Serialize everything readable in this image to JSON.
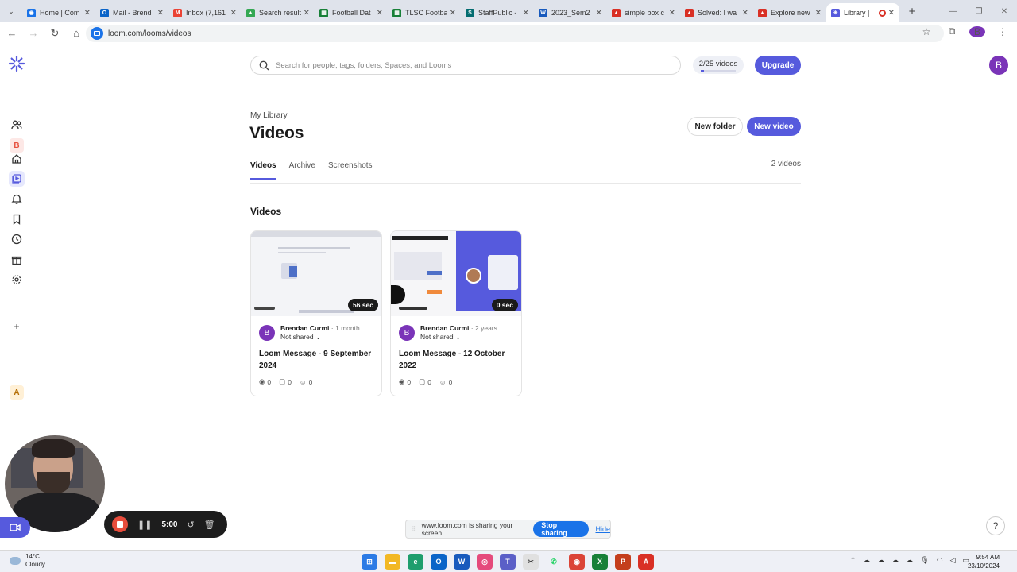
{
  "browser": {
    "tabs": [
      {
        "title": "Home | Com",
        "color": "#1a73e8",
        "glyph": "◉"
      },
      {
        "title": "Mail - Brend",
        "color": "#0a64c8",
        "glyph": "O"
      },
      {
        "title": "Inbox (7,161",
        "color": "#ea4335",
        "glyph": "M"
      },
      {
        "title": "Search result",
        "color": "#34a853",
        "glyph": "▲"
      },
      {
        "title": "Football Dat",
        "color": "#188038",
        "glyph": "▦"
      },
      {
        "title": "TLSC Footba",
        "color": "#188038",
        "glyph": "▦"
      },
      {
        "title": "StaffPublic -",
        "color": "#036c70",
        "glyph": "S"
      },
      {
        "title": "2023_Sem2",
        "color": "#185abd",
        "glyph": "W"
      },
      {
        "title": "simple box c",
        "color": "#d93025",
        "glyph": "▲"
      },
      {
        "title": "Solved: I wa",
        "color": "#d93025",
        "glyph": "▲"
      },
      {
        "title": "Explore new",
        "color": "#d93025",
        "glyph": "▲"
      },
      {
        "title": "Library |",
        "color": "#565add",
        "glyph": "✳"
      }
    ],
    "url": "loom.com/looms/videos",
    "profile_initial": "B"
  },
  "sidebar": {
    "workspace_initial": "B",
    "workspace2_initial": "A"
  },
  "search": {
    "placeholder": "Search for people, tags, folders, Spaces, and Looms"
  },
  "quota": {
    "label": "2/25 videos",
    "fraction": 0.08
  },
  "upgrade_label": "Upgrade",
  "user_initial": "B",
  "page": {
    "breadcrumb": "My Library",
    "title": "Videos",
    "new_folder_label": "New folder",
    "new_video_label": "New video",
    "tabs": [
      "Videos",
      "Archive",
      "Screenshots"
    ],
    "video_count": "2 videos",
    "section_title": "Videos"
  },
  "videos": [
    {
      "author": "Brendan Curmi",
      "age": "1 month",
      "sharing": "Not shared",
      "title": "Loom Message - 9 September 2024",
      "duration": "56 sec",
      "views": "0",
      "comments": "0",
      "reactions": "0",
      "initial": "B"
    },
    {
      "author": "Brendan Curmi",
      "age": "2 years",
      "sharing": "Not shared",
      "title": "Loom Message - 12 October 2022",
      "duration": "0 sec",
      "views": "0",
      "comments": "0",
      "reactions": "0",
      "initial": "B"
    }
  ],
  "recorder": {
    "time": "5:00"
  },
  "share_bar": {
    "message": "www.loom.com is sharing your screen.",
    "stop_label": "Stop sharing",
    "hide_label": "Hide"
  },
  "help_label": "?",
  "taskbar": {
    "temp": "14°C",
    "condition": "Cloudy",
    "time": "9:54 AM",
    "date": "23/10/2024"
  }
}
